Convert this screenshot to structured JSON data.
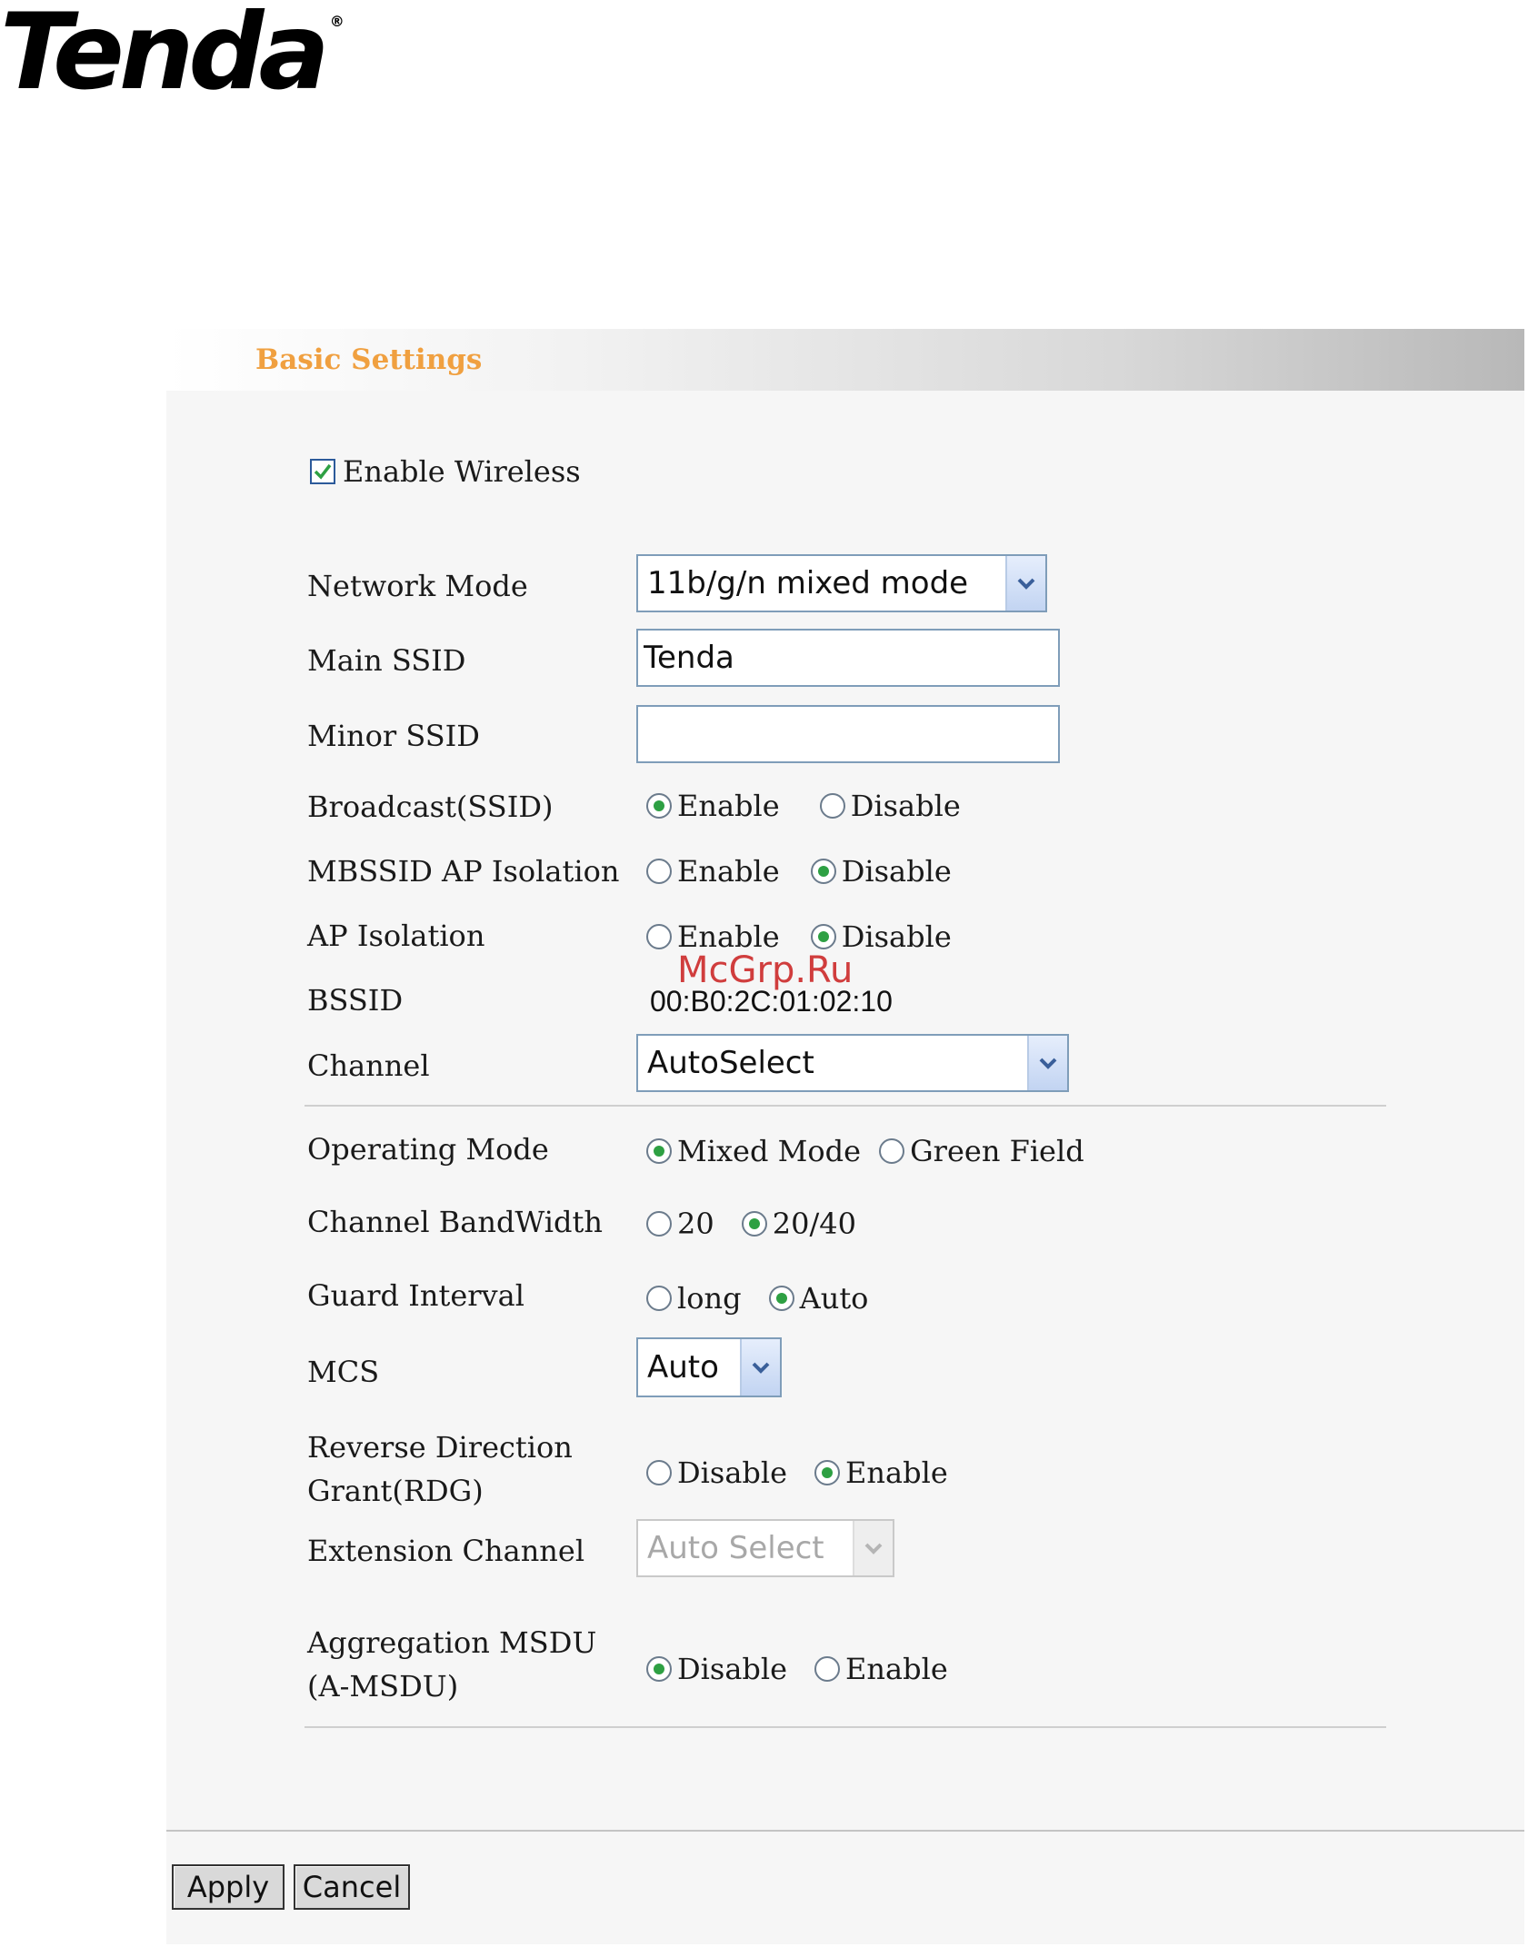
{
  "brand": {
    "logo_text": "Tenda",
    "registered_mark": "®"
  },
  "watermark": "McGrp.Ru",
  "panel": {
    "title": "Basic Settings"
  },
  "enable_wireless": {
    "label": "Enable Wireless",
    "checked": true
  },
  "fields": {
    "network_mode": {
      "label": "Network Mode",
      "value": "11b/g/n mixed mode"
    },
    "main_ssid": {
      "label": "Main SSID",
      "value": "Tenda"
    },
    "minor_ssid": {
      "label": "Minor SSID",
      "value": ""
    },
    "broadcast_ssid": {
      "label": "Broadcast(SSID)",
      "options": [
        "Enable",
        "Disable"
      ],
      "selected": "Enable"
    },
    "mbssid_ap_isolation": {
      "label": "MBSSID AP Isolation",
      "options": [
        "Enable",
        "Disable"
      ],
      "selected": "Disable"
    },
    "ap_isolation": {
      "label": "AP Isolation",
      "options": [
        "Enable",
        "Disable"
      ],
      "selected": "Disable"
    },
    "bssid": {
      "label": "BSSID",
      "value": "00:B0:2C:01:02:10"
    },
    "channel": {
      "label": "Channel",
      "value": "AutoSelect"
    },
    "operating_mode": {
      "label": "Operating Mode",
      "options": [
        "Mixed Mode",
        "Green Field"
      ],
      "selected": "Mixed Mode"
    },
    "channel_bandwidth": {
      "label": "Channel BandWidth",
      "options": [
        "20",
        "20/40"
      ],
      "selected": "20/40"
    },
    "guard_interval": {
      "label": "Guard Interval",
      "options": [
        "long",
        "Auto"
      ],
      "selected": "Auto"
    },
    "mcs": {
      "label": "MCS",
      "value": "Auto"
    },
    "rdg": {
      "label_line1": "Reverse Direction",
      "label_line2": "Grant(RDG)",
      "options": [
        "Disable",
        "Enable"
      ],
      "selected": "Enable"
    },
    "extension_channel": {
      "label": "Extension Channel",
      "value": "Auto Select",
      "disabled": true
    },
    "amsdu": {
      "label_line1": "Aggregation MSDU",
      "label_line2": "(A-MSDU)",
      "options": [
        "Disable",
        "Enable"
      ],
      "selected": "Disable"
    }
  },
  "buttons": {
    "apply": "Apply",
    "cancel": "Cancel"
  },
  "colors": {
    "title": "#f0a040",
    "radio_selected": "#2ea043",
    "checkbox_mark": "#2ea043",
    "watermark": "#cc2a2a"
  }
}
